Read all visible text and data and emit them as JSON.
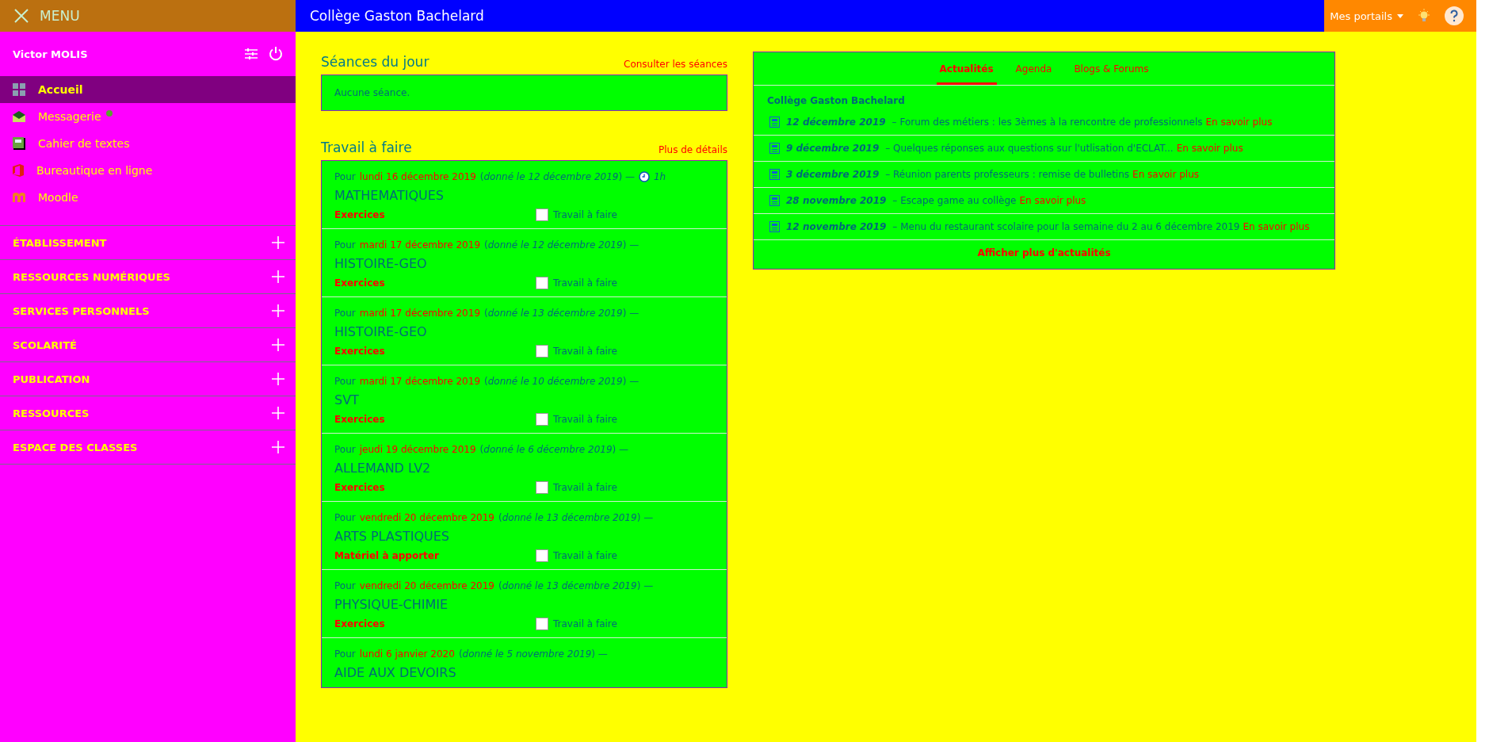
{
  "header": {
    "menu_label": "MENU",
    "school": "Collège Gaston Bachelard",
    "portals": "Mes portails"
  },
  "sidebar": {
    "user": "Victor MOLIS",
    "apps": [
      {
        "kind": "grid",
        "label": "Accueil",
        "selected": true,
        "unread": false
      },
      {
        "kind": "mail",
        "label": "Messagerie",
        "selected": false,
        "unread": true
      },
      {
        "kind": "notebook",
        "label": "Cahier de textes",
        "selected": false,
        "unread": false
      },
      {
        "kind": "office",
        "label": "Bureautique en ligne",
        "selected": false,
        "unread": false
      },
      {
        "kind": "moodle",
        "label": "Moodle",
        "selected": false,
        "unread": false
      }
    ],
    "sections": [
      {
        "label": "ÉTABLISSEMENT",
        "expanded": false
      },
      {
        "label": "RESSOURCES NUMÉRIQUES",
        "expanded": false
      },
      {
        "label": "SERVICES PERSONNELS",
        "expanded": false
      },
      {
        "label": "SCOLARITÉ",
        "expanded": false
      },
      {
        "label": "PUBLICATION",
        "expanded": false
      },
      {
        "label": "RESSOURCES",
        "expanded": false
      },
      {
        "label": "ESPACE DES CLASSES",
        "expanded": false
      }
    ]
  },
  "sessions": {
    "title": "Séances du jour",
    "link": "Consulter les séances",
    "empty": "Aucune séance."
  },
  "homework": {
    "title": "Travail à faire",
    "link": "Plus de détails",
    "items": [
      {
        "prefix": "Pour",
        "due": "lundi 16 décembre 2019",
        "given": "(*donné le 12 décembre 2019*) —",
        "duration": "1h",
        "subject": "MATHEMATIQUES",
        "type": "Exercices",
        "done_label": "Travail à faire",
        "checked": false
      },
      {
        "prefix": "Pour",
        "due": "mardi 17 décembre 2019",
        "given": "(*donné le 12 décembre 2019*) —",
        "subject": "HISTOIRE-GEO",
        "type": "Exercices",
        "done_label": "Travail à faire",
        "checked": false
      },
      {
        "prefix": "Pour",
        "due": "mardi 17 décembre 2019",
        "given": "(*donné le 13 décembre 2019*) —",
        "subject": "HISTOIRE-GEO",
        "type": "Exercices",
        "done_label": "Travail à faire",
        "checked": false
      },
      {
        "prefix": "Pour",
        "due": "mardi 17 décembre 2019",
        "given": "(*donné le 10 décembre 2019*) —",
        "subject": "SVT",
        "type": "Exercices",
        "done_label": "Travail à faire",
        "checked": false
      },
      {
        "prefix": "Pour",
        "due": "jeudi 19 décembre 2019",
        "given": "(*donné le 6 décembre 2019*) —",
        "subject": "ALLEMAND LV2",
        "type": "Exercices",
        "done_label": "Travail à faire",
        "checked": false
      },
      {
        "prefix": "Pour",
        "due": "vendredi 20 décembre 2019",
        "given": "(*donné le 13 décembre 2019*) —",
        "subject": "ARTS PLASTIQUES",
        "type": "Matériel à apporter",
        "done_label": "Travail à faire",
        "checked": false
      },
      {
        "prefix": "Pour",
        "due": "vendredi 20 décembre 2019",
        "given": "(*donné le 13 décembre 2019*) —",
        "subject": "PHYSIQUE-CHIMIE",
        "type": "Exercices",
        "done_label": "Travail à faire",
        "checked": false
      },
      {
        "prefix": "Pour",
        "due": "lundi 6 janvier 2020",
        "given": "(*donné le 5 novembre 2019*) —",
        "subject": "AIDE AUX DEVOIRS"
      }
    ]
  },
  "news": {
    "tabs": [
      {
        "label": "Actualités",
        "selected": true
      },
      {
        "label": "Agenda",
        "selected": false
      },
      {
        "label": "Blogs & Forums",
        "selected": false
      }
    ],
    "source": "Collège Gaston Bachelard",
    "items": [
      {
        "date": "12 décembre 2019",
        "text": "– Forum des métiers : les 3èmes à la rencontre de professionnels",
        "link": "En savoir plus"
      },
      {
        "date": "9 décembre 2019",
        "text": "– Quelques réponses aux questions sur l'utlisation d'ECLAT...",
        "link": "En savoir plus"
      },
      {
        "date": "3 décembre 2019",
        "text": "– Réunion parents professeurs : remise de bulletins",
        "link": "En savoir plus"
      },
      {
        "date": "28 novembre 2019",
        "text": "– Escape game au collège",
        "link": "En savoir plus"
      },
      {
        "date": "12 novembre 2019",
        "text": "– Menu du restaurant scolaire pour la semaine du 2 au 6 décembre 2019",
        "link": "En savoir plus"
      }
    ],
    "more": "Afficher plus d'actualités"
  }
}
